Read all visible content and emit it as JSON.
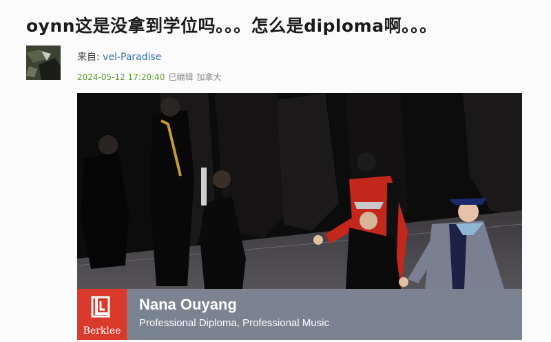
{
  "post": {
    "title": "oynn这是没拿到学位吗。。。怎么是diploma啊。。。"
  },
  "author": {
    "source_prefix": "来自: ",
    "source_name": "vel-Paradise",
    "timestamp": "2024-05-12 17:20:40",
    "edited_label": "已编辑",
    "location": "加拿大"
  },
  "video": {
    "lower_third": {
      "logo_text": "Berklee",
      "name": "Nana Ouyang",
      "program": "Professional Diploma, Professional Music"
    }
  },
  "colors": {
    "link": "#2f6db3",
    "timestamp": "#5a9a2a",
    "berklee_red": "#d93a2b",
    "lower_third_bg": "#7b8391"
  }
}
